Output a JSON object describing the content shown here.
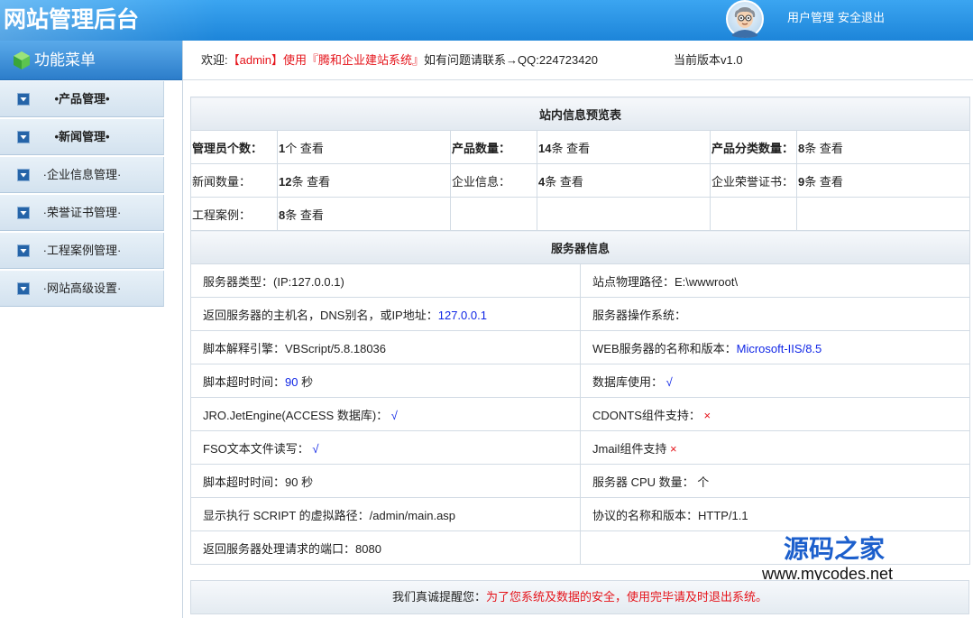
{
  "header": {
    "title": "网站管理后台",
    "user_admin": "用户管理",
    "logout": "安全退出",
    "avatar_icon": "cartoon-user-avatar-icon"
  },
  "sidebar": {
    "title": "功能菜单",
    "title_icon": "green-cube-icon",
    "item_icon": "blue-chevron-down-box-icon",
    "items": [
      {
        "label": "•产品管理•"
      },
      {
        "label": "•新闻管理•"
      },
      {
        "label": "·企业信息管理·"
      },
      {
        "label": "·荣誉证书管理·"
      },
      {
        "label": "·工程案例管理·"
      },
      {
        "label": "·网站高级设置·"
      }
    ]
  },
  "topbar": {
    "welcome_prefix": "欢迎:",
    "welcome_highlight": "【admin】使用『腾和企业建站系统』",
    "welcome_suffix": "如有问题请联系→QQ:224723420",
    "version": "当前版本v1.0"
  },
  "site_info": {
    "title": "站内信息预览表",
    "rows": [
      [
        {
          "label": "管理员个数：",
          "count": "1",
          "unit": "个",
          "link": "查看"
        },
        {
          "label": "产品数量：",
          "count": "14",
          "unit": "条",
          "link": "查看"
        },
        {
          "label": "产品分类数量：",
          "count": "8",
          "unit": "条",
          "link": "查看"
        }
      ],
      [
        {
          "label": "新闻数量：",
          "count": "12",
          "unit": "条",
          "link": "查看"
        },
        {
          "label": "企业信息：",
          "count": "4",
          "unit": "条",
          "link": "查看"
        },
        {
          "label": "企业荣誉证书：",
          "count": "9",
          "unit": "条",
          "link": "查看"
        }
      ],
      [
        {
          "label": "工程案例：",
          "count": "8",
          "unit": "条",
          "link": "查看"
        }
      ]
    ]
  },
  "server_info": {
    "title": "服务器信息",
    "rows": [
      {
        "left": {
          "label": "服务器类型：(IP:127.0.0.1)",
          "value": "",
          "suffix": "",
          "tone": "plain"
        },
        "right": {
          "label": "站点物理路径：E:\\wwwroot\\",
          "value": "",
          "suffix": "",
          "tone": "plain"
        }
      },
      {
        "left": {
          "label": "返回服务器的主机名，DNS别名，或IP地址：",
          "value": "127.0.0.1",
          "suffix": "",
          "tone": "blue"
        },
        "right": {
          "label": "服务器操作系统：",
          "value": "",
          "suffix": "",
          "tone": "plain"
        }
      },
      {
        "left": {
          "label": "脚本解释引擎：VBScript/5.8.18036",
          "value": "",
          "suffix": "",
          "tone": "plain"
        },
        "right": {
          "label": "WEB服务器的名称和版本：",
          "value": "Microsoft-IIS/8.5",
          "suffix": "",
          "tone": "blue"
        }
      },
      {
        "left": {
          "label": "脚本超时时间：",
          "value": "90",
          "suffix": " 秒",
          "tone": "blue"
        },
        "right": {
          "label": "数据库使用： ",
          "value": "√",
          "suffix": "",
          "tone": "blue"
        }
      },
      {
        "left": {
          "label": "JRO.JetEngine(ACCESS 数据库)： ",
          "value": "√",
          "suffix": "",
          "tone": "blue"
        },
        "right": {
          "label": "CDONTS组件支持： ",
          "value": "×",
          "suffix": "",
          "tone": "red"
        }
      },
      {
        "left": {
          "label": "FSO文本文件读写： ",
          "value": "√",
          "suffix": "",
          "tone": "blue"
        },
        "right": {
          "label": "Jmail组件支持 ",
          "value": "×",
          "suffix": "",
          "tone": "red"
        }
      },
      {
        "left": {
          "label": "脚本超时时间：90 秒",
          "value": "",
          "suffix": "",
          "tone": "plain"
        },
        "right": {
          "label": "服务器 CPU 数量： 个",
          "value": "",
          "suffix": "",
          "tone": "plain"
        }
      },
      {
        "left": {
          "label": "显示执行 SCRIPT 的虚拟路径：/admin/main.asp",
          "value": "",
          "suffix": "",
          "tone": "plain"
        },
        "right": {
          "label": "协议的名称和版本：HTTP/1.1",
          "value": "",
          "suffix": "",
          "tone": "plain"
        }
      },
      {
        "left": {
          "label": "返回服务器处理请求的端口：8080",
          "value": "",
          "suffix": "",
          "tone": "plain"
        },
        "right": {
          "label": "",
          "value": "",
          "suffix": "",
          "tone": "plain"
        }
      }
    ]
  },
  "notice": {
    "prefix": "我们真诚提醒您：",
    "highlight": "为了您系统及数据的安全，使用完毕请及时退出系统。"
  },
  "watermark": {
    "brand": "源码之家",
    "url": "www.mycodes.net"
  },
  "colors": {
    "header": "#2a90e4",
    "blue": "#1026e6",
    "red": "#e5141b"
  }
}
